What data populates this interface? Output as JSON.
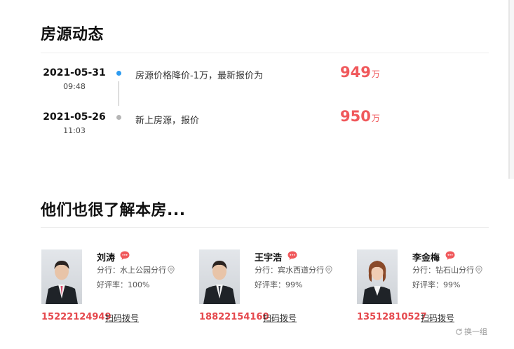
{
  "history": {
    "title": "房源动态",
    "entries": [
      {
        "date": "2021-05-31",
        "time": "09:48",
        "desc": "房源价格降价-1万，最新报价为",
        "price": "949",
        "unit": "万",
        "dot_color": "#2d9bf0"
      },
      {
        "date": "2021-05-26",
        "time": "11:03",
        "desc": "新上房源，报价",
        "price": "950",
        "unit": "万",
        "dot_color": "#b5b5b5"
      }
    ]
  },
  "agents_section": {
    "title": "他们也很了解本房...",
    "agents": [
      {
        "name": "刘涛",
        "branch": "分行：水上公园分行",
        "rating": "好评率：100%",
        "phone": "15222124949",
        "scan_label": "扫码拨号",
        "photo": "agent-photo-male"
      },
      {
        "name": "王宇浩",
        "branch": "分行：宾水西道分行",
        "rating": "好评率：99%",
        "phone": "18822154160",
        "scan_label": "扫码拨号",
        "photo": "agent-photo-male"
      },
      {
        "name": "李金梅",
        "branch": "分行：钻石山分行",
        "rating": "好评率：99%",
        "phone": "13512810527",
        "scan_label": "扫码拨号",
        "photo": "agent-photo-female"
      }
    ],
    "refresh_label": "换一组"
  },
  "icons": {
    "chat": "chat-bubble-icon",
    "location": "location-pin-icon",
    "refresh": "refresh-icon"
  },
  "colors": {
    "price": "#f0585b",
    "phone": "#e5484d",
    "dot_active": "#2d9bf0",
    "dot_inactive": "#b5b5b5",
    "chat_icon": "#f0585b"
  }
}
